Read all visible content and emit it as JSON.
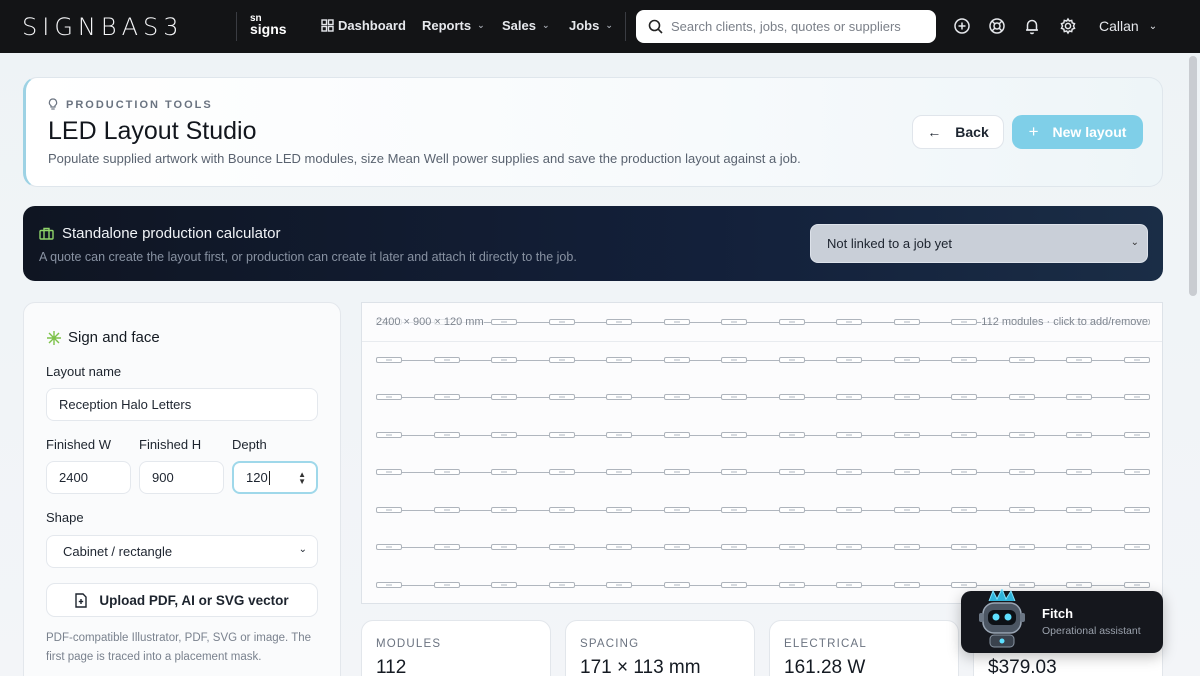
{
  "nav": {
    "brand": "SIGNBAS3",
    "sublogo_top": "sn",
    "sublogo_bottom": "signs",
    "items": [
      {
        "label": "Dashboard",
        "icon": "grid-icon"
      },
      {
        "label": "Reports",
        "icon": "chevron-down-icon"
      },
      {
        "label": "Sales",
        "icon": "chevron-down-icon"
      },
      {
        "label": "Jobs",
        "icon": "chevron-down-icon"
      }
    ],
    "search_placeholder": "Search clients, jobs, quotes or suppliers",
    "icons": [
      "plus-circle-icon",
      "support-icon",
      "bell-icon",
      "gear-icon"
    ],
    "user": "Callan"
  },
  "header": {
    "eyebrow": "PRODUCTION TOOLS",
    "title": "LED Layout Studio",
    "subtitle": "Populate supplied artwork with Bounce LED modules, size Mean Well power supplies and save the production layout against a job.",
    "back_label": "Back",
    "new_label": "New layout"
  },
  "banner": {
    "title": "Standalone production calculator",
    "subtitle": "A quote can create the layout first, or production can create it later and attach it directly to the job.",
    "job_select": "Not linked to a job yet"
  },
  "sign": {
    "title": "Sign and face",
    "layout_name_label": "Layout name",
    "layout_name_value": "Reception Halo Letters",
    "width_label": "Finished W",
    "width_value": "2400",
    "height_label": "Finished H",
    "height_value": "900",
    "depth_label": "Depth",
    "depth_value": "120",
    "shape_label": "Shape",
    "shape_value": "Cabinet / rectangle",
    "upload_label": "Upload PDF, AI or SVG vector",
    "help_text": "PDF-compatible Illustrator, PDF, SVG or image. The first page is traced into a placement mask."
  },
  "canvas": {
    "dims": "2400 × 900 × 120 mm",
    "info": "112 modules · click to add/remove",
    "rows": 8,
    "cols": 14
  },
  "stats": [
    {
      "label": "MODULES",
      "value": "112"
    },
    {
      "label": "SPACING",
      "value": "171 × 113 mm"
    },
    {
      "label": "ELECTRICAL",
      "value": "161.28 W"
    },
    {
      "label": "",
      "value": "$379.03"
    }
  ],
  "assistant": {
    "name": "Fitch",
    "role": "Operational assistant"
  }
}
